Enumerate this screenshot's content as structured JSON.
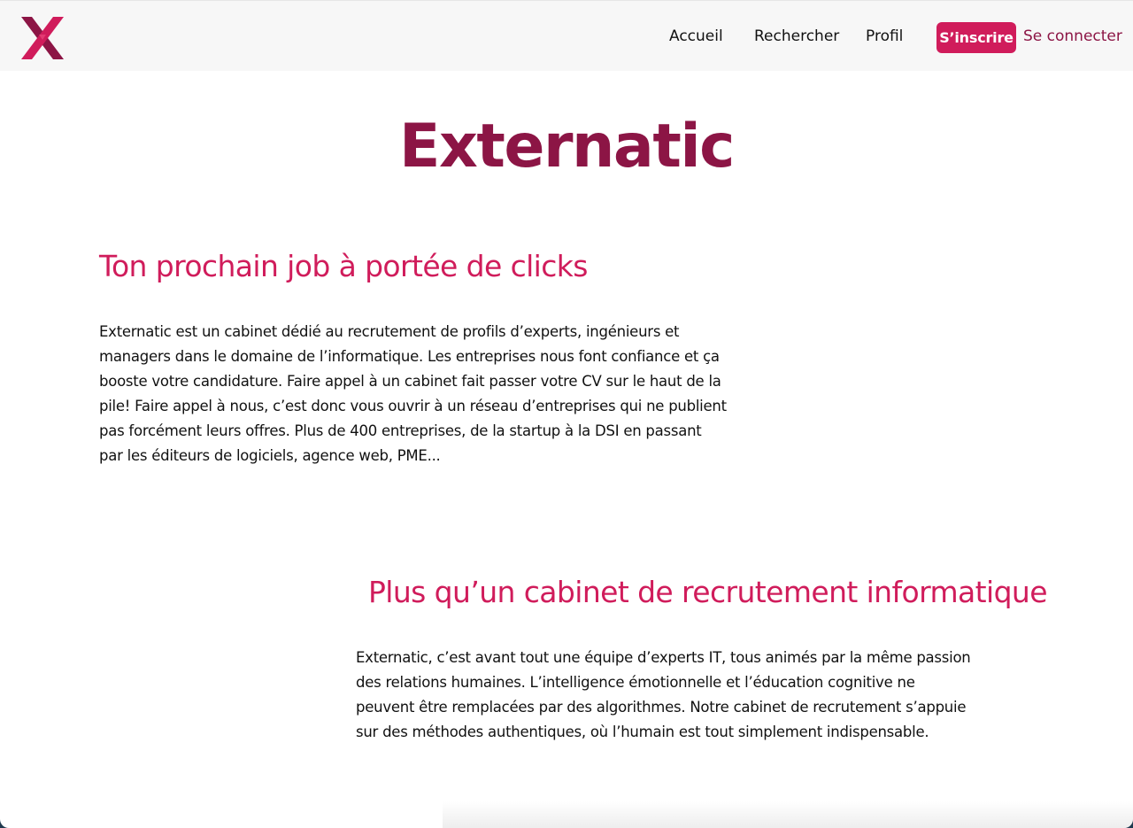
{
  "header": {
    "logo_icon": "externatic-x-logo-icon",
    "nav": {
      "accueil": "Accueil",
      "rechercher": "Rechercher",
      "profil": "Profil"
    },
    "signup_label": "S’inscrire",
    "login_label": "Se connecter"
  },
  "main": {
    "title": "Externatic",
    "section1": {
      "heading": "Ton prochain job à portée de clicks",
      "text": "Externatic est un cabinet dédié au recrutement de profils d’experts, ingénieurs et managers dans le domaine de l’informatique. Les entreprises nous font confiance et ça booste votre candidature. Faire appel à un cabinet fait passer votre CV sur le haut de la pile! Faire appel à nous, c’est donc vous ouvrir à un réseau d’entreprises qui ne publient pas forcément leurs offres. Plus de 400 entreprises, de la startup à la DSI en passant par les éditeurs de logiciels, agence web, PME..."
    },
    "section2": {
      "heading": "Plus qu’un cabinet de recrutement informatique",
      "text": "Externatic, c’est avant tout une équipe d’experts IT, tous animés par la même passion des relations humaines. L’intelligence émotionnelle et l’éducation cognitive ne peuvent être remplacées par des algorithmes. Notre cabinet de recrutement s’appuie sur des méthodes authentiques, où l’humain est tout simplement indispensable."
    }
  },
  "colors": {
    "brand_dark": "#8c1545",
    "brand_accent": "#d01c5b",
    "navbar_bg": "#f7f7f7"
  }
}
